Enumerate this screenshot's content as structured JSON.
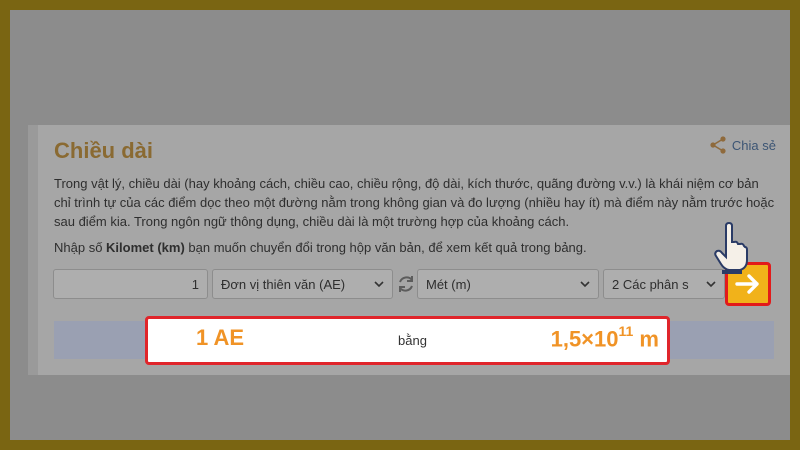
{
  "section": {
    "title": "Chiều dài",
    "share_label": "Chia sẻ",
    "description": "Trong vật lý, chiều dài (hay khoảng cách, chiều cao, chiều rộng, độ dài, kích thước, quãng đường v.v.) là khái niệm cơ bản chỉ trình tự của các điểm dọc theo một đường nằm trong không gian và đo lượng (nhiều hay ít) mà điểm này nằm trước hoặc sau điểm kia. Trong ngôn ngữ thông dụng, chiều dài là một trường hợp của khoảng cách.",
    "instruction_prefix": "Nhập số ",
    "instruction_unit": "Kilomet (km)",
    "instruction_suffix": " bạn muốn chuyển đổi trong hộp văn bản, để xem kết quả trong bảng."
  },
  "converter": {
    "input_value": "1",
    "from_unit": "Đơn vị thiên văn (AE)",
    "to_unit": "Mét (m)",
    "precision": "2 Các phân s",
    "go_icon": "arrow-right-icon",
    "swap_icon": "swap-icon"
  },
  "result": {
    "left": "1 AE",
    "middle": "bằng",
    "right_mantissa": "1,5×10",
    "right_exponent": "11",
    "right_unit": " m"
  },
  "colors": {
    "title": "#8a6a32",
    "accent": "#f09326",
    "highlight_border": "#e0252b",
    "button": "#f1b21a"
  }
}
